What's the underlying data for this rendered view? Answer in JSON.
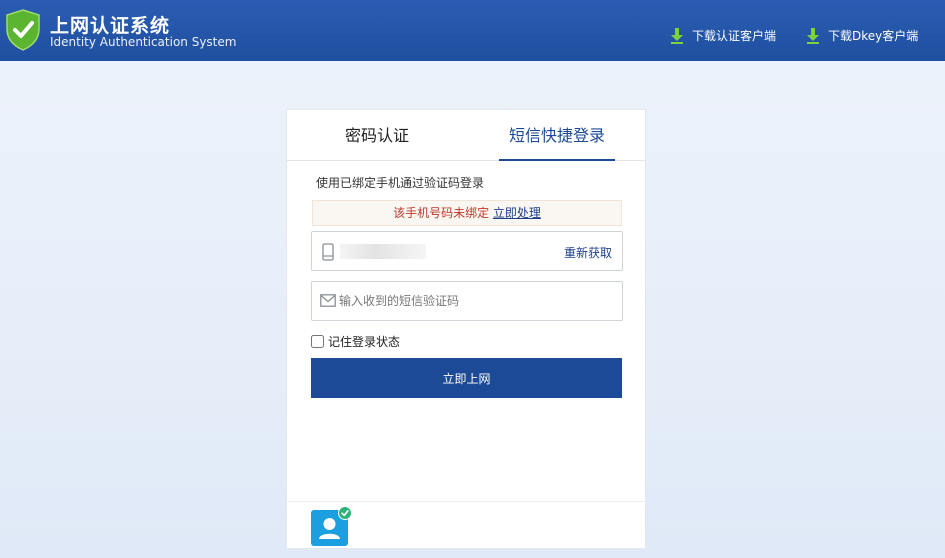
{
  "header": {
    "title": "上网认证系统",
    "subtitle": "Identity Authentication System",
    "download_client_label": "下载认证客户端",
    "download_dkey_label": "下载Dkey客户端"
  },
  "tabs": {
    "password_label": "密码认证",
    "sms_label": "短信快捷登录",
    "active": "sms"
  },
  "form": {
    "hint": "使用已绑定手机通过验证码登录",
    "alert_text": "该手机号码未绑定",
    "alert_link": "立即处理",
    "resend_label": "重新获取",
    "code_placeholder": "输入收到的短信验证码",
    "code_value": "",
    "remember_label": "记住登录状态",
    "remember_checked": false,
    "submit_label": "立即上网"
  },
  "colors": {
    "header_bg": "#2358ad",
    "primary": "#1c4a96",
    "alert_text": "#c0392b",
    "avatar": "#1b9fe0",
    "badge": "#2db37a",
    "shield": "#5cb531"
  },
  "icons": {
    "logo": "shield-check-icon",
    "download": "download-arrow-icon",
    "phone": "phone-icon",
    "mail": "mail-icon",
    "avatar": "user-icon",
    "badge": "check-circle-icon"
  }
}
